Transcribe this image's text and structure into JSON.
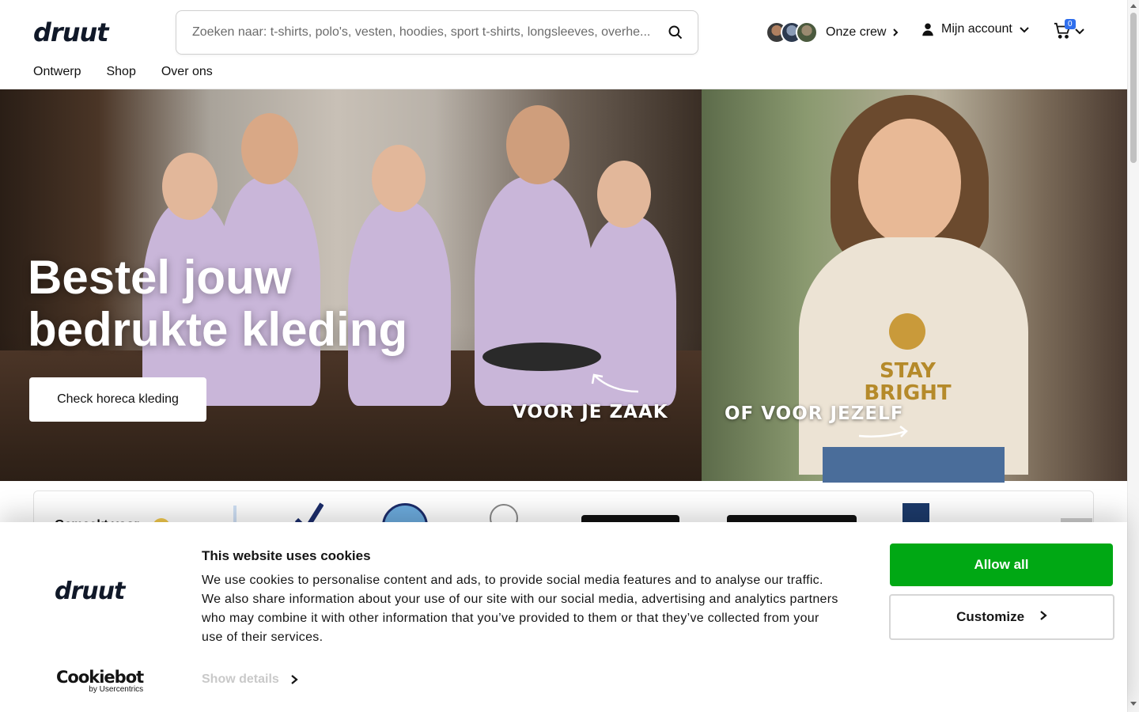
{
  "header": {
    "logo": "druut",
    "search_placeholder": "Zoeken naar: t-shirts, polo's, vesten, hoodies, sport t-shirts, longsleeves, overhe...",
    "crew_label": "Onze crew",
    "account_label": "Mijn account",
    "cart_count": "0"
  },
  "nav": {
    "items": [
      "Ontwerp",
      "Shop",
      "Over ons"
    ]
  },
  "hero": {
    "title_line1": "Bestel jouw",
    "title_line2": "bedrukte kleding",
    "cta": "Check horeca kleding",
    "tag_business": "VOOR JE ZAAK",
    "tag_self": "OF VOOR JEZELF",
    "shirt_print": "STAY BRIGHT"
  },
  "logos": {
    "label": "Gemaakt voor",
    "brands": [
      "Manchester City",
      "ASA Lanai",
      "studenten"
    ]
  },
  "cookie": {
    "logo": "druut",
    "title": "This website uses cookies",
    "text": "We use cookies to personalise content and ads, to provide social media features and to analyse our traffic. We also share information about your use of our site with our social media, advertising and analytics partners who may combine it with other information that you’ve provided to them or that they’ve collected from your use of their services.",
    "show_details": "Show details",
    "allow_all": "Allow all",
    "customize": "Customize",
    "cookiebot_main": "Cookiebot",
    "cookiebot_sub": "by Usercentrics"
  },
  "colors": {
    "allow_green": "#00a814",
    "cart_badge_blue": "#2f6fed",
    "logo_navy": "#101828"
  }
}
